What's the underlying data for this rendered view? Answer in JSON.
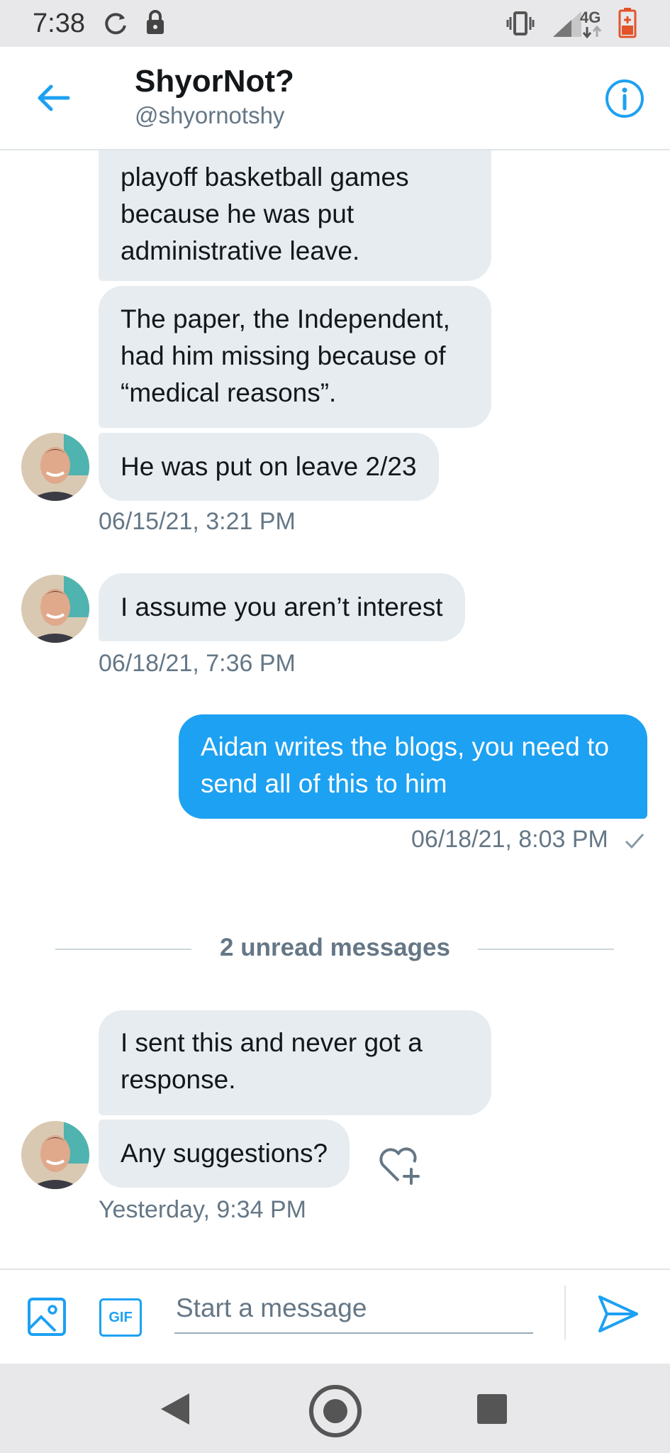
{
  "status_bar": {
    "time": "7:38",
    "network": "4G",
    "icons": [
      "sync-icon",
      "lock-icon",
      "vibrate-icon",
      "signal-icon",
      "battery-icon"
    ]
  },
  "header": {
    "title": "ShyorNot?",
    "handle": "@shyornotshy",
    "icons": [
      "back-arrow-icon",
      "info-icon"
    ]
  },
  "messages": {
    "m1": "playoff basketball games because he was put administrative leave.",
    "m2": "The paper, the Independent, had him missing because of “medical reasons”.",
    "m3": "He was put on leave 2/23",
    "ts1": "06/15/21, 3:21 PM",
    "m4": "I assume you aren’t interest",
    "ts2": "06/18/21, 7:36 PM",
    "m5": "Aidan writes the blogs, you need to send all of this to him",
    "ts3": "06/18/21, 8:03 PM",
    "unread": "2 unread messages",
    "m6": "I sent this and never got a response.",
    "m7": "Any suggestions?",
    "ts4": "Yesterday, 9:34 PM"
  },
  "composer": {
    "gif_label": "GIF",
    "placeholder": "Start a message",
    "icons": [
      "image-icon",
      "send-icon"
    ]
  },
  "colors": {
    "accent": "#1da1f2",
    "incoming_bubble": "#e6ecf0",
    "secondary_text": "#657786"
  }
}
